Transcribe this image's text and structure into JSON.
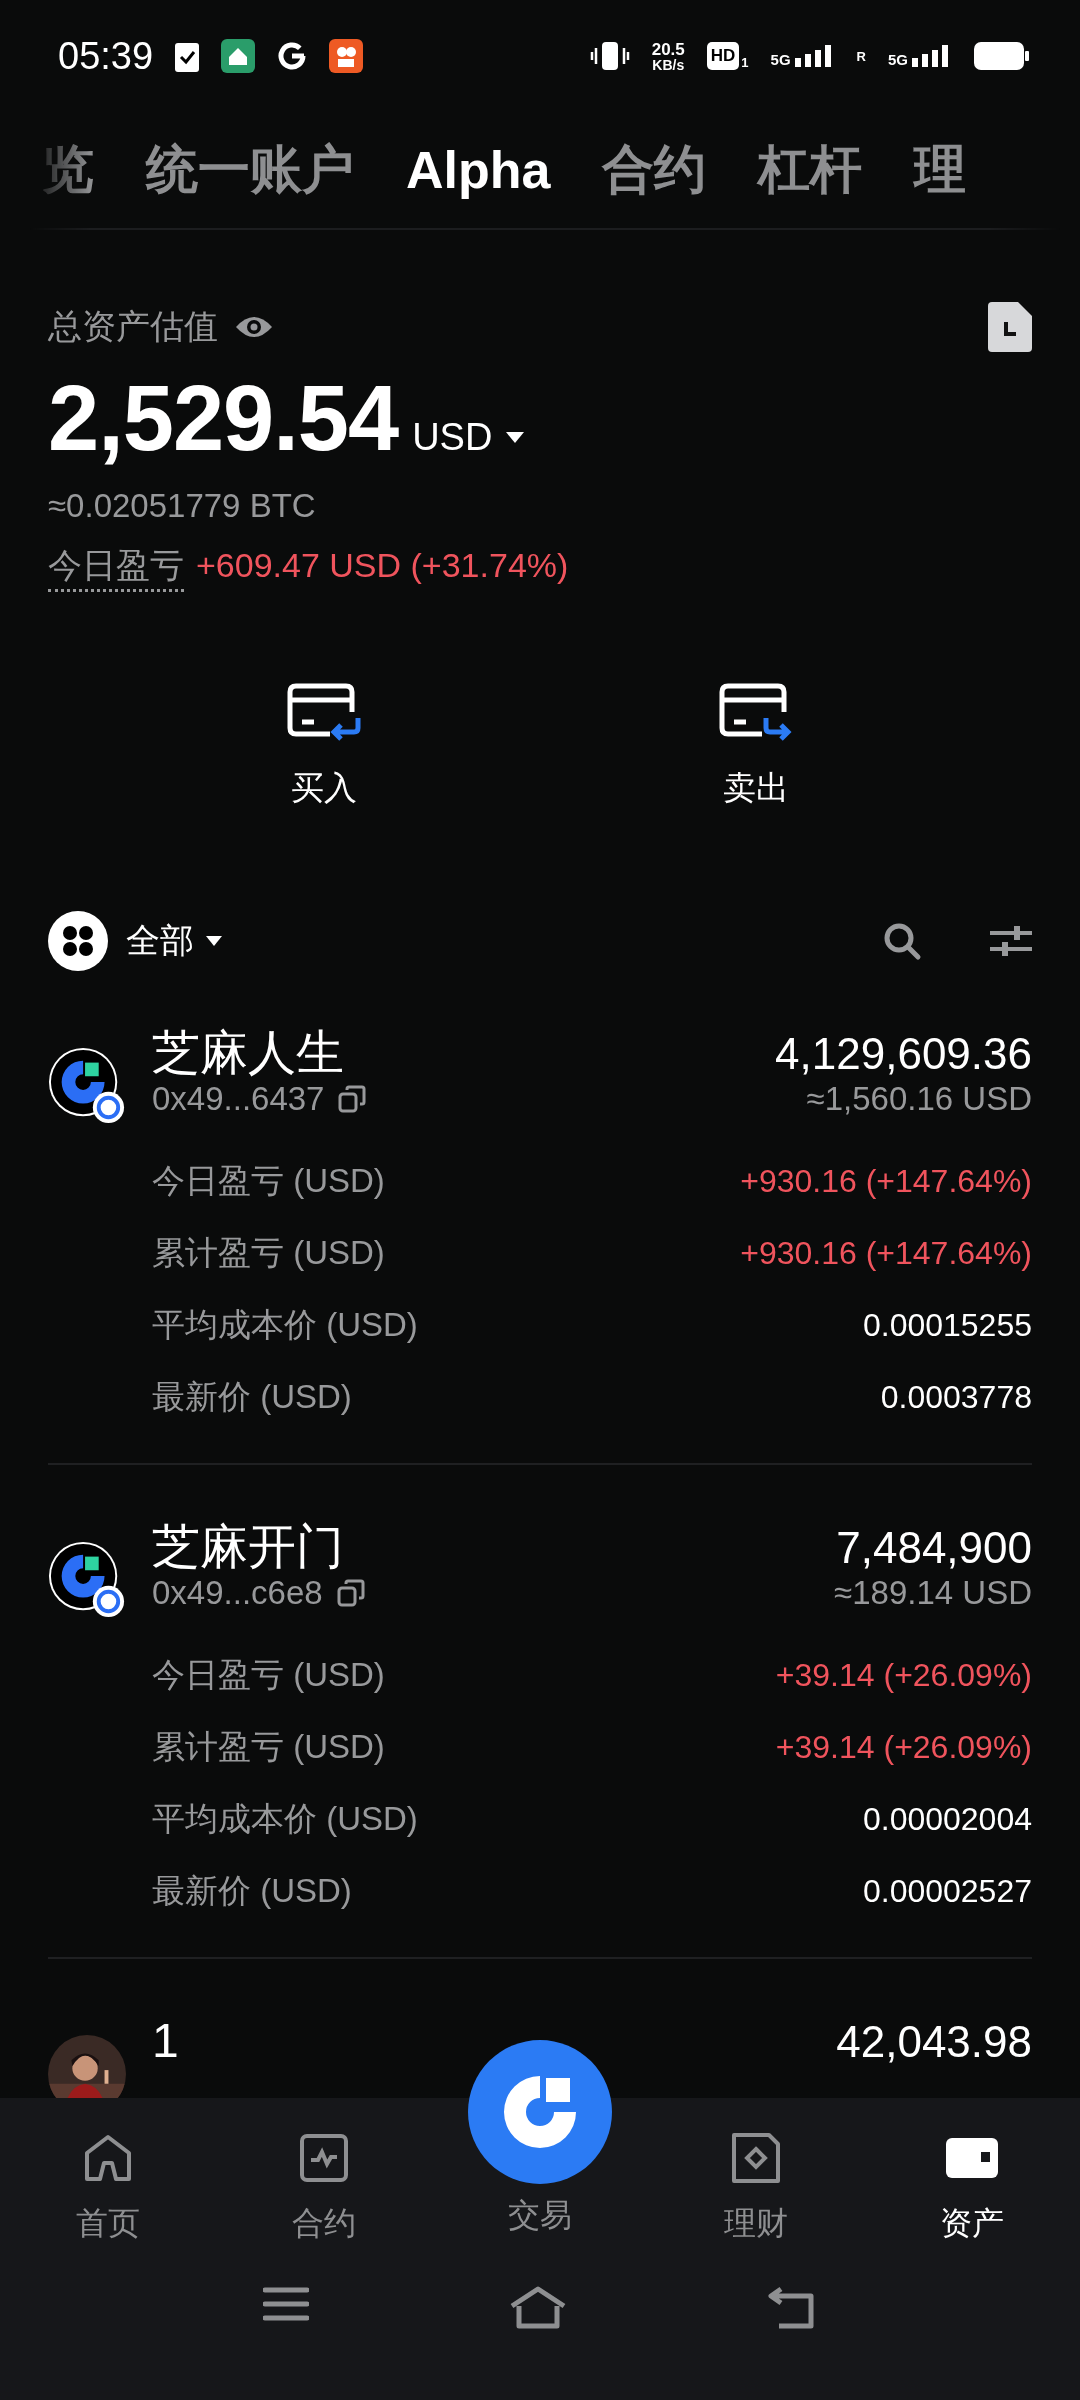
{
  "status_bar": {
    "time": "05:39",
    "net_speed": "20.5",
    "net_unit": "KB/s",
    "hd": "HD",
    "hd_sub": "1",
    "sim1": "5G",
    "roaming": "R",
    "sim2": "5G"
  },
  "tabs": [
    {
      "label": "览",
      "selected": false
    },
    {
      "label": "统一账户",
      "selected": false
    },
    {
      "label": "Alpha",
      "selected": true
    },
    {
      "label": "合约",
      "selected": false
    },
    {
      "label": "杠杆",
      "selected": false
    },
    {
      "label": "理",
      "selected": false
    }
  ],
  "summary": {
    "label": "总资产估值",
    "value": "2,529.54",
    "currency": "USD",
    "btc": "≈0.02051779 BTC",
    "pnl_label": "今日盈亏",
    "pnl": "+609.47 USD (+31.74%)"
  },
  "actions": [
    {
      "label": "买入",
      "kind": "buy"
    },
    {
      "label": "卖出",
      "kind": "sell"
    }
  ],
  "filter": {
    "label": "全部"
  },
  "tokens": [
    {
      "kind": "logo",
      "name": "芝麻人生",
      "address": "0x49...6437",
      "amount": "4,129,609.36",
      "value": "≈1,560.16 USD",
      "details": [
        {
          "label": "今日盈亏 (USD)",
          "value": "+930.16 (+147.64%)",
          "kind": "gain"
        },
        {
          "label": "累计盈亏 (USD)",
          "value": "+930.16 (+147.64%)",
          "kind": "gain"
        },
        {
          "label": "平均成本价 (USD)",
          "value": "0.00015255",
          "kind": "plain"
        },
        {
          "label": "最新价 (USD)",
          "value": "0.0003778",
          "kind": "plain"
        }
      ]
    },
    {
      "kind": "logo",
      "name": "芝麻开门",
      "address": "0x49...c6e8",
      "amount": "7,484,900",
      "value": "≈189.14 USD",
      "details": [
        {
          "label": "今日盈亏 (USD)",
          "value": "+39.14 (+26.09%)",
          "kind": "gain"
        },
        {
          "label": "累计盈亏 (USD)",
          "value": "+39.14 (+26.09%)",
          "kind": "gain"
        },
        {
          "label": "平均成本价 (USD)",
          "value": "0.00002004",
          "kind": "plain"
        },
        {
          "label": "最新价 (USD)",
          "value": "0.00002527",
          "kind": "plain"
        }
      ]
    },
    {
      "kind": "picture",
      "name": "1",
      "amount": "42,043.98"
    }
  ],
  "nav": [
    {
      "label": "首页",
      "kind": "home",
      "selected": false
    },
    {
      "label": "合约",
      "kind": "chart",
      "selected": false
    },
    {
      "label": "交易",
      "kind": "trade",
      "selected": false
    },
    {
      "label": "理财",
      "kind": "diamond",
      "selected": false
    },
    {
      "label": "资产",
      "kind": "wallet",
      "selected": true
    }
  ]
}
